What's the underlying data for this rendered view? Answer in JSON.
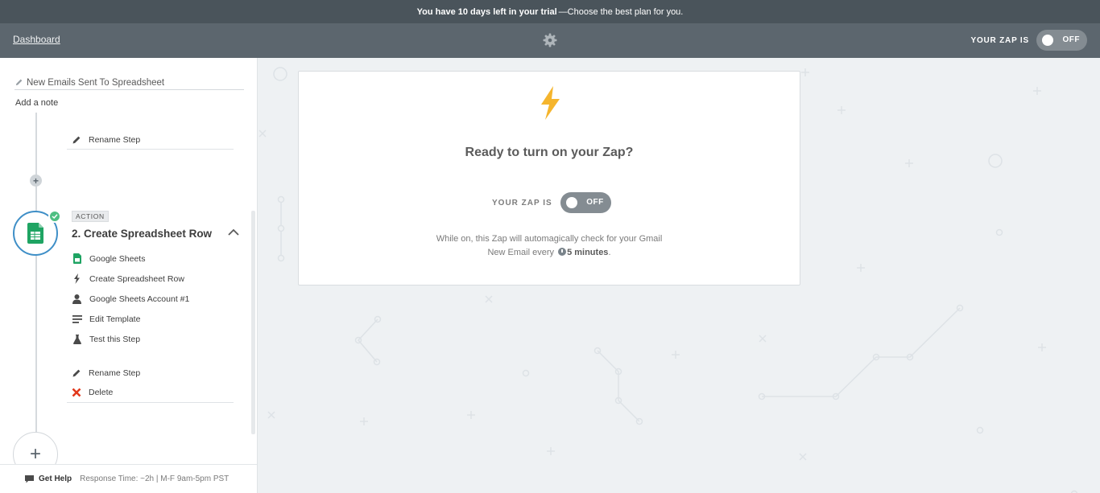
{
  "trial_bar": {
    "highlight": "You have 10 days left in your trial",
    "rest": "—Choose the best plan for you."
  },
  "header": {
    "dashboard_label": "Dashboard",
    "zap_status_label": "YOUR ZAP IS",
    "toggle_state": "OFF"
  },
  "sidebar": {
    "zap_name": "New Emails Sent To Spreadsheet",
    "add_note": "Add a note",
    "step1_rename": "Rename Step",
    "step2": {
      "badge": "ACTION",
      "title": "2. Create Spreadsheet Row",
      "items": [
        {
          "label": "Google Sheets",
          "icon": "google-sheets-icon"
        },
        {
          "label": "Create Spreadsheet Row",
          "icon": "bolt-icon"
        },
        {
          "label": "Google Sheets Account #1",
          "icon": "user-icon"
        },
        {
          "label": "Edit Template",
          "icon": "lines-icon"
        },
        {
          "label": "Test this Step",
          "icon": "flask-icon"
        }
      ],
      "rename": "Rename Step",
      "delete": "Delete"
    },
    "help": {
      "label": "Get Help",
      "response_time": "Response Time: ~2h | M-F 9am-5pm PST"
    }
  },
  "main": {
    "ready_title": "Ready to turn on your Zap?",
    "status_label": "YOUR ZAP IS",
    "toggle_state": "OFF",
    "desc_line1": "While on, this Zap will automagically check for your Gmail",
    "desc_line2_prefix": "New Email every",
    "desc_interval": "5 minutes",
    "desc_suffix": "."
  },
  "colors": {
    "trial_bar": "#4a545b",
    "header": "#5c666e",
    "accent_blue": "#3f8fc7",
    "success_green": "#4ebf82",
    "bolt_orange": "#f5b52d",
    "delete_red": "#e1381b",
    "sheets_green": "#1fa463"
  }
}
